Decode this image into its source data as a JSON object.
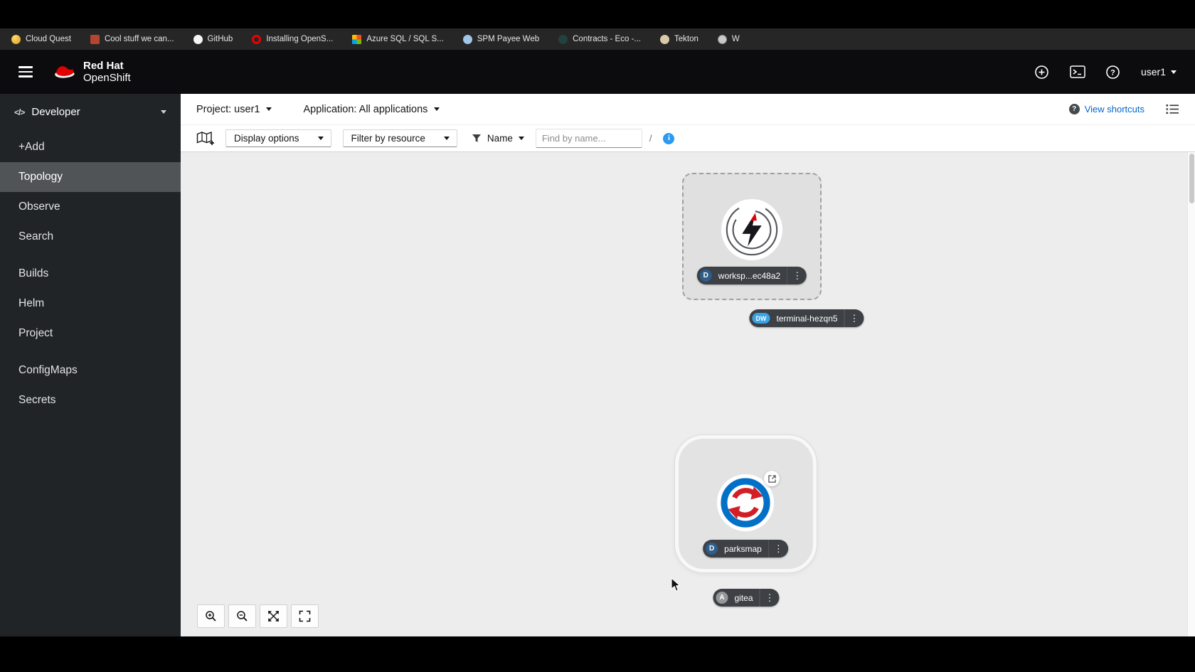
{
  "colors": {
    "brand_red": "#ee0000",
    "header_bg": "#0c0c0e",
    "sidebar_bg": "#212427",
    "sidebar_active_bg": "#515457",
    "canvas_bg": "#ededed",
    "link_blue": "#0066cc",
    "info_blue": "#2b9af3",
    "badge_deployment": "#2e5e8a",
    "badge_devworkspace": "#37a3e8",
    "badge_application": "#95979a",
    "label_pill_bg": "#3d4045",
    "parksmap_blue": "#0370c8",
    "parksmap_red": "#d21f26"
  },
  "bookmarks_bar": {
    "items": [
      {
        "label": "Cloud Quest",
        "icon": "cloud-quest-favicon"
      },
      {
        "label": "Cool stuff we can...",
        "icon": "book-favicon"
      },
      {
        "label": "GitHub",
        "icon": "github-favicon"
      },
      {
        "label": "Installing OpenS...",
        "icon": "openshift-favicon"
      },
      {
        "label": "Azure SQL / SQL S...",
        "icon": "azure-favicon"
      },
      {
        "label": "SPM Payee Web",
        "icon": "spm-favicon"
      },
      {
        "label": "Contracts - Eco -...",
        "icon": "contracts-favicon"
      },
      {
        "label": "Tekton",
        "icon": "tekton-favicon"
      },
      {
        "label": "W",
        "icon": "globe-favicon"
      }
    ]
  },
  "header": {
    "brand": {
      "line1": "Red Hat",
      "line2": "OpenShift"
    },
    "user_menu": "user1"
  },
  "sidebar": {
    "perspective": "Developer",
    "groups": [
      {
        "items": [
          {
            "label": "+Add"
          },
          {
            "label": "Topology",
            "active": true
          },
          {
            "label": "Observe"
          },
          {
            "label": "Search"
          }
        ]
      },
      {
        "items": [
          {
            "label": "Builds"
          },
          {
            "label": "Helm"
          },
          {
            "label": "Project"
          }
        ]
      },
      {
        "items": [
          {
            "label": "ConfigMaps"
          },
          {
            "label": "Secrets"
          }
        ]
      }
    ]
  },
  "context_bar": {
    "project": "Project: user1",
    "application": "Application: All applications",
    "view_shortcuts": "View shortcuts"
  },
  "toolbar": {
    "display_options": "Display options",
    "filter_by_resource": "Filter by resource",
    "name_filter": "Name",
    "find_placeholder": "Find by name...",
    "find_value": "",
    "shortcut_hint": "/"
  },
  "topology": {
    "nodes": [
      {
        "name": "workspace-deployment",
        "label": "worksp...ec48a2",
        "badge": "D"
      },
      {
        "name": "terminal-devworkspace",
        "label": "terminal-hezqn5",
        "badge": "DW"
      },
      {
        "name": "parksmap-deployment",
        "label": "parksmap",
        "badge": "D"
      },
      {
        "name": "gitea-application",
        "label": "gitea",
        "badge": "A"
      }
    ]
  },
  "zoom_controls": {
    "buttons": [
      "zoom-in",
      "zoom-out",
      "fit-to-screen",
      "reset-view"
    ]
  }
}
